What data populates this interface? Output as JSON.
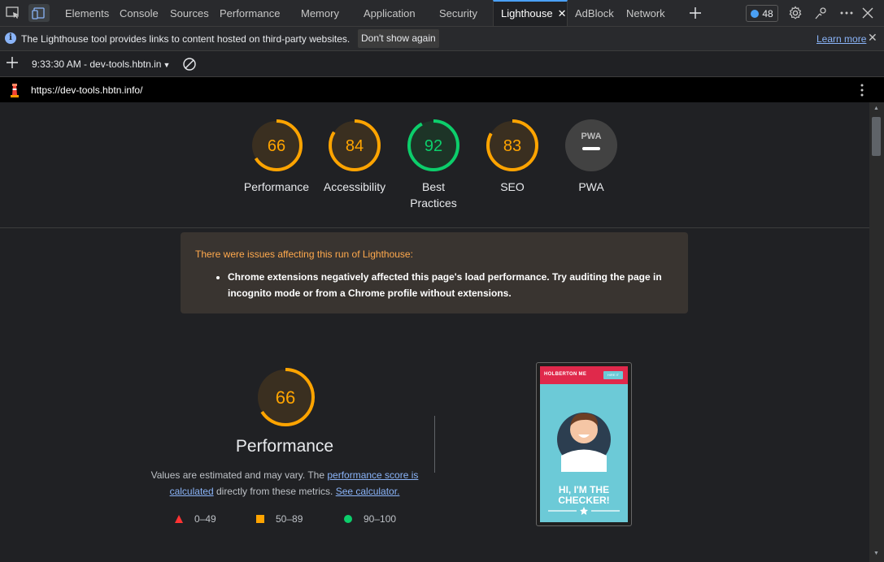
{
  "tabs": [
    {
      "label": "Elements"
    },
    {
      "label": "Console"
    },
    {
      "label": "Sources"
    },
    {
      "label": "Performance"
    },
    {
      "label": "Memory"
    },
    {
      "label": "Application"
    },
    {
      "label": "Security"
    },
    {
      "label": "Lighthouse",
      "active": true
    },
    {
      "label": "AdBlock"
    },
    {
      "label": "Network"
    }
  ],
  "toolbar": {
    "issues_count": "48"
  },
  "infobar": {
    "message": "The Lighthouse tool provides links to content hosted on third-party websites.",
    "dont_show_label": "Don't show again",
    "learn_more_label": "Learn more"
  },
  "report": {
    "time_label": "9:33:30 AM - dev-tools.hbtn.in",
    "url": "https://dev-tools.hbtn.info/"
  },
  "gauges": [
    {
      "score": "66",
      "label": "Performance",
      "value": 66,
      "status": "average"
    },
    {
      "score": "84",
      "label": "Accessibility",
      "value": 84,
      "status": "average"
    },
    {
      "score": "92",
      "label": "Best Practices",
      "value": 92,
      "status": "pass"
    },
    {
      "score": "83",
      "label": "SEO",
      "value": 83,
      "status": "average"
    },
    {
      "score": "",
      "label": "PWA",
      "badge": "PWA",
      "status": "na"
    }
  ],
  "warning": {
    "title": "There were issues affecting this run of Lighthouse:",
    "items": [
      "Chrome extensions negatively affected this page's load performance. Try auditing the page in incognito mode or from a Chrome profile without extensions."
    ]
  },
  "performance": {
    "score": "66",
    "value": 66,
    "title": "Performance",
    "desc_prefix": "Values are estimated and may vary. The ",
    "link1": "performance score is calculated",
    "desc_mid": " directly from these metrics. ",
    "link2": "See calculator.",
    "legend": [
      {
        "range": "0–49",
        "shape": "triangle",
        "color": "#f33"
      },
      {
        "range": "50–89",
        "shape": "square",
        "color": "#ffa400"
      },
      {
        "range": "90–100",
        "shape": "circle",
        "color": "#0cce6b"
      }
    ]
  },
  "screenshot": {
    "brand": "HOLBERTON ME",
    "button": "HIRE IT",
    "headline": "HI, I'M THE CHECKER!"
  },
  "colors": {
    "average": "#ffa400",
    "pass": "#0cce6b",
    "fail": "#f33",
    "link": "#8ab4f8",
    "accent": "#4aa0f5"
  }
}
